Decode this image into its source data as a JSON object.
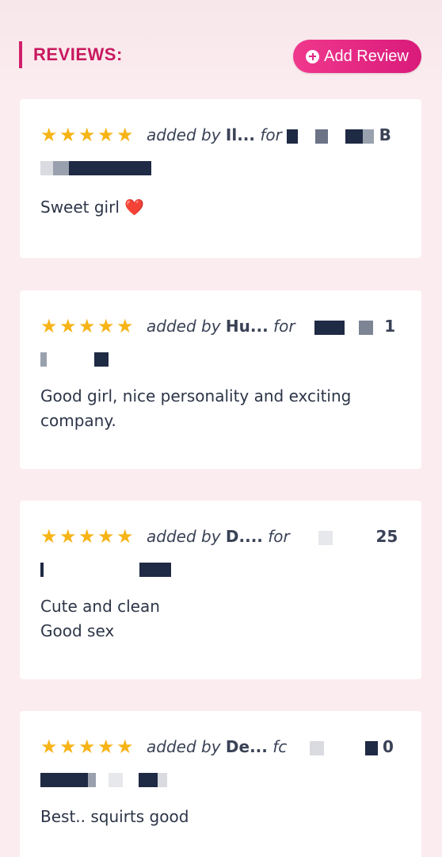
{
  "section": {
    "title": "REVIEWS:",
    "add_button_label": "Add Review"
  },
  "colors": {
    "accent": "#d11f6a",
    "button": "#e02a84",
    "star": "#f6b417",
    "background": "#fbecef"
  },
  "reviews": [
    {
      "rating": 5,
      "added_by_label": "added by",
      "author": "Il...",
      "for_label": "for",
      "meta_tail": "B",
      "text": "Sweet girl",
      "emoji": "❤️"
    },
    {
      "rating": 5,
      "added_by_label": "added by",
      "author": "Hu...",
      "for_label": "for",
      "meta_tail": "1",
      "text": "Good girl, nice personality and exciting company."
    },
    {
      "rating": 5,
      "added_by_label": "added by",
      "author": "D....",
      "for_label": "for",
      "meta_tail": "25",
      "text_line1": "Cute and clean",
      "text_line2": "Good sex"
    },
    {
      "rating": 5,
      "added_by_label": "added by",
      "author": "De...",
      "for_label": "fc",
      "meta_tail": "0",
      "text": "Best.. squirts good"
    }
  ]
}
